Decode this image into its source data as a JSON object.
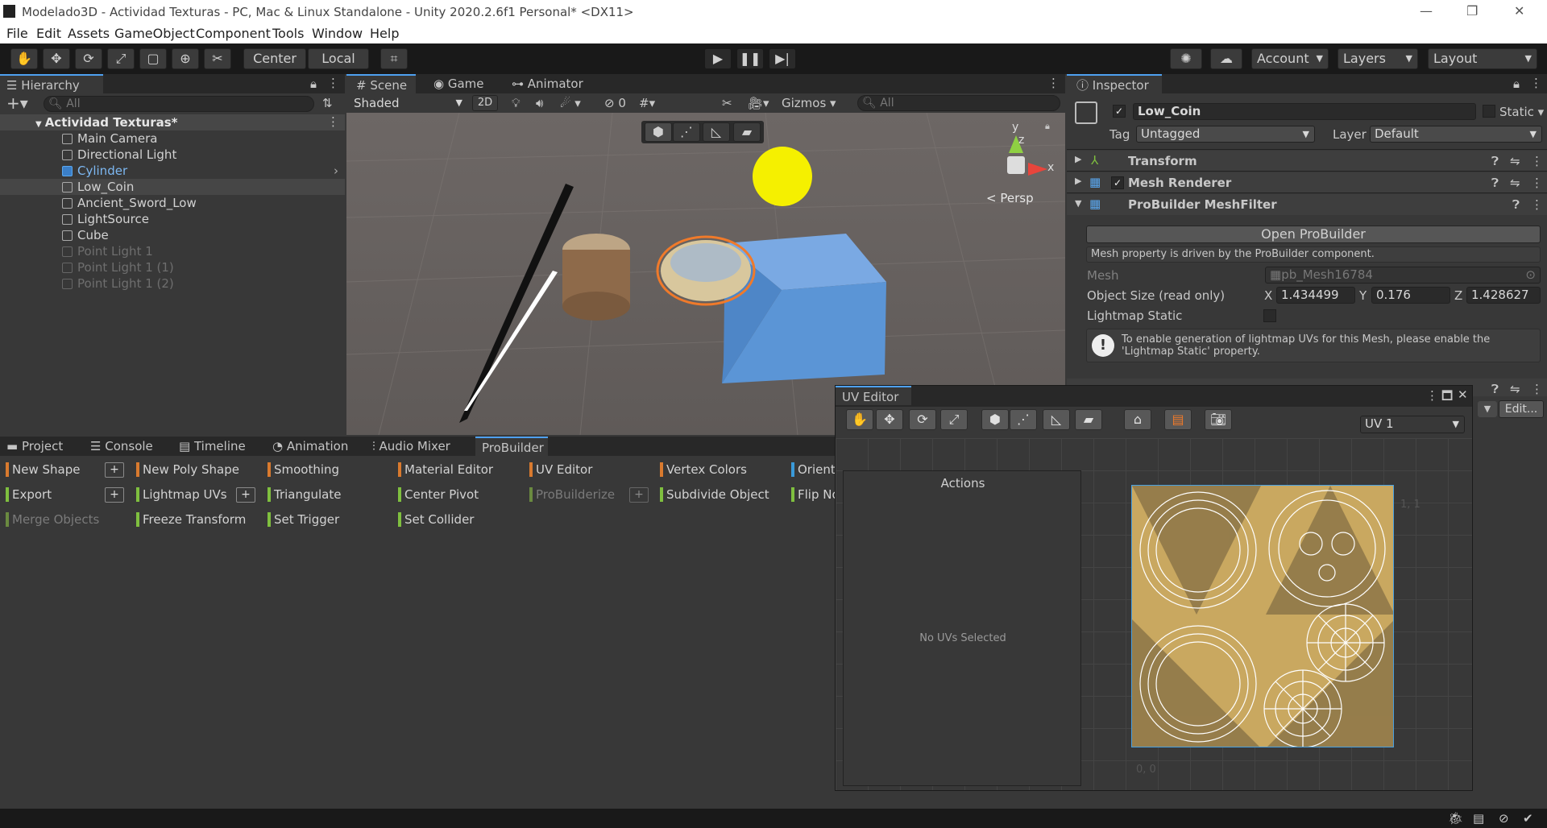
{
  "titlebar": {
    "title": "Modelado3D - Actividad Texturas - PC, Mac & Linux Standalone - Unity 2020.2.6f1 Personal* <DX11>",
    "minimize": "—",
    "restore": "❐",
    "close": "✕"
  },
  "menu": [
    "File",
    "Edit",
    "Assets",
    "GameObject",
    "Component",
    "Tools",
    "Window",
    "Help"
  ],
  "toolbar": {
    "center": "Center",
    "local": "Local",
    "account": "Account",
    "layers": "Layers",
    "layout": "Layout",
    "play_icon": "play-icon",
    "pause_icon": "pause-icon",
    "step_icon": "step-icon"
  },
  "hierarchy": {
    "tab": "Hierarchy",
    "search_placeholder": "All",
    "scene": "Actividad Texturas*",
    "items": [
      "Main Camera",
      "Directional Light",
      "Cylinder",
      "Low_Coin",
      "Ancient_Sword_Low",
      "LightSource",
      "Cube",
      "Point Light 1",
      "Point Light 1 (1)",
      "Point Light 1 (2)"
    ]
  },
  "scene": {
    "tabs": [
      "Scene",
      "Game",
      "Animator"
    ],
    "shading": "Shaded",
    "mode_2d": "2D",
    "hidden_count": "0",
    "gizmos": "Gizmos",
    "search_placeholder": "All",
    "persp": "Persp",
    "axis_x": "x",
    "axis_y": "y",
    "axis_z": "z"
  },
  "bottom": {
    "tabs": [
      "Project",
      "Console",
      "Timeline",
      "Animation",
      "Audio Mixer",
      "ProBuilder"
    ],
    "pb_col1": [
      "New Shape",
      "Export",
      "Merge Objects"
    ],
    "pb_col2": [
      "New Poly Shape",
      "Lightmap UVs",
      "Freeze Transform"
    ],
    "pb_col3": [
      "Smoothing",
      "Triangulate",
      "Set Trigger"
    ],
    "pb_col4": [
      "Material Editor",
      "Center Pivot",
      "Set Collider"
    ],
    "pb_col5": [
      "UV Editor",
      "ProBuilderize"
    ],
    "pb_col6": [
      "Vertex Colors",
      "Subdivide Object"
    ],
    "pb_col7": [
      "Orienta",
      "Flip No"
    ],
    "plus": "+"
  },
  "inspector": {
    "tab": "Inspector",
    "object_name": "Low_Coin",
    "static": "Static",
    "tag_label": "Tag",
    "tag_value": "Untagged",
    "layer_label": "Layer",
    "layer_value": "Default",
    "components": [
      "Transform",
      "Mesh Renderer",
      "ProBuilder MeshFilter"
    ],
    "open_probuilder": "Open ProBuilder",
    "driven_note": "Mesh property is driven by the ProBuilder component.",
    "mesh_label": "Mesh",
    "mesh_value": "pb_Mesh16784",
    "size_label": "Object Size (read only)",
    "size_x_label": "X",
    "size_x": "1.434499",
    "size_y_label": "Y",
    "size_y": "0.176",
    "size_z_label": "Z",
    "size_z": "1.428627",
    "lightmap_static": "Lightmap Static",
    "lightmap_help": "To enable generation of lightmap UVs for this Mesh, please enable the 'Lightmap Static' property.",
    "edit_button": "Edit..."
  },
  "uv_editor": {
    "title": "UV Editor",
    "channel": "UV 1",
    "actions_title": "Actions",
    "no_uvs": "No UVs Selected",
    "coord_11": "1, 1",
    "coord_00": "0, 0"
  },
  "colors": {
    "accent": "#4ea0f0",
    "selection_orange": "#f07a2a",
    "gold": "#c9a860",
    "cube_blue": "#5b95d6",
    "sun": "#f5f000"
  }
}
